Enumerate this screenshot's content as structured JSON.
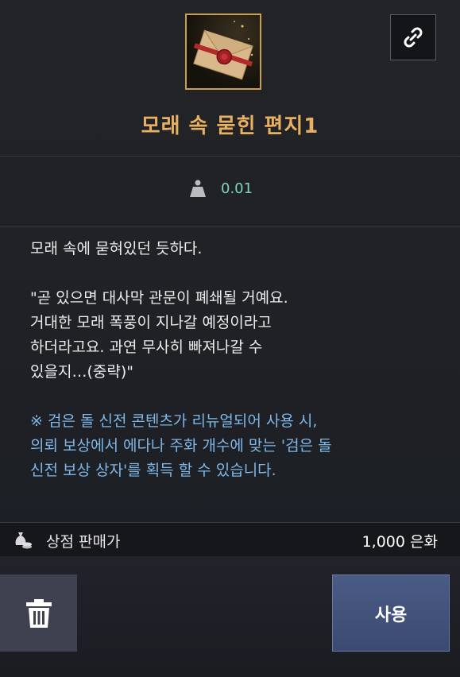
{
  "item": {
    "name": "모래 속 묻힌 편지1",
    "icon": "sealed-letter-icon",
    "link_icon": "chain-link-icon"
  },
  "weight": {
    "icon": "weight-icon",
    "value": "0.01"
  },
  "description": {
    "intro": "모래 속에 묻혀있던 듯하다.",
    "quote": "\"곧 있으면 대사막 관문이 폐쇄될 거예요.\n거대한 모래 폭풍이 지나갈 예정이라고\n하더라고요. 과연 무사히 빠져나갈 수\n있을지…(중략)\"",
    "notice": "※ 검은 돌 신전 콘텐츠가 리뉴얼되어 사용 시,\n의뢰 보상에서 에다나 주화 개수에 맞는 '검은 돌\n신전 보상 상자'를 획득 할 수 있습니다."
  },
  "price": {
    "icon": "coin-bag-icon",
    "label": "상점 판매가",
    "value": "1,000 은화"
  },
  "actions": {
    "trash_icon": "trash-icon",
    "use_label": "사용"
  },
  "colors": {
    "item_name": "#e7b062",
    "weight_value": "#7fd4b8",
    "notice_text": "#7fb8e8",
    "use_button": "#4a5b85"
  }
}
